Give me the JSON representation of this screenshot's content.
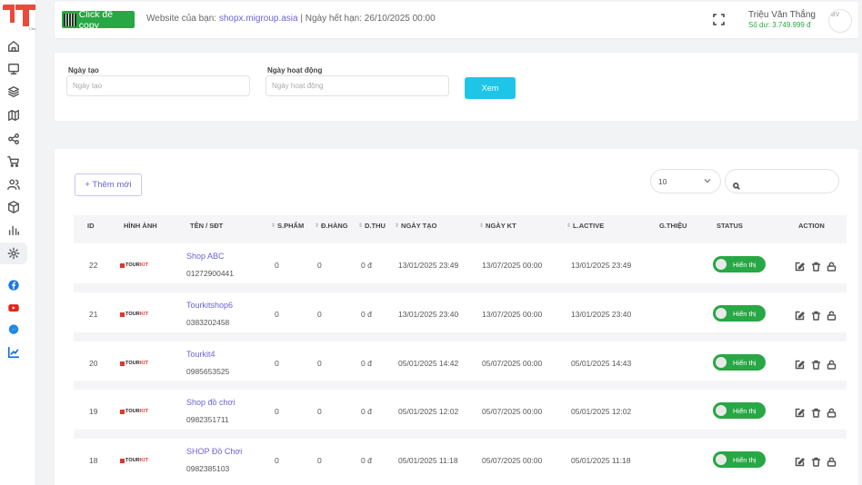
{
  "header": {
    "copy_label": "Click để copy",
    "site_prefix": "Website của bạn: ",
    "site_url": "shopx.migroup.asia",
    "expiry": " | Ngày hết hạn: 26/10/2025 00:00",
    "user_name": "Triệu Văn Thắng",
    "balance": "Số dư: 3.749.999 đ",
    "avatar_alt": "BV"
  },
  "filter": {
    "created_label": "Ngày tạo",
    "created_placeholder": "Ngày tạo",
    "active_label": "Ngày hoạt động",
    "active_placeholder": "Ngày hoạt động",
    "view_label": "Xem"
  },
  "table": {
    "add_label": "+ Thêm mới",
    "page_size": "10",
    "columns": {
      "id": "ID",
      "image": "HÌNH ẢNH",
      "name": "TÊN / SĐT",
      "products": "S.PHẨM",
      "orders": "Đ.HÀNG",
      "revenue": "D.THU",
      "created": "NGÀY TẠO",
      "expiry": "NGÀY KT",
      "last_active": "L.ACTIVE",
      "referral": "G.THIỆU",
      "status": "STATUS",
      "action": "ACTION"
    },
    "rows": [
      {
        "id": "22",
        "name": "Shop ABC",
        "phone": "01272900441",
        "products": "0",
        "orders": "0",
        "revenue": "0 đ",
        "created": "13/01/2025 23:49",
        "expiry": "13/07/2025 00:00",
        "last_active": "13/01/2025 23:49",
        "status": "Hiển thị"
      },
      {
        "id": "21",
        "name": "Tourkitshop6",
        "phone": "0383202458",
        "products": "0",
        "orders": "0",
        "revenue": "0 đ",
        "created": "13/01/2025 23:40",
        "expiry": "13/07/2025 00:00",
        "last_active": "13/01/2025 23:40",
        "status": "Hiển thị"
      },
      {
        "id": "20",
        "name": "Tourkit4",
        "phone": "0985653525",
        "products": "0",
        "orders": "0",
        "revenue": "0 đ",
        "created": "05/01/2025 14:42",
        "expiry": "05/07/2025 00:00",
        "last_active": "05/01/2025 14:43",
        "status": "Hiển thị"
      },
      {
        "id": "19",
        "name": "Shop đồ chơi",
        "phone": "0982351711",
        "products": "0",
        "orders": "0",
        "revenue": "0 đ",
        "created": "05/01/2025 12:02",
        "expiry": "05/07/2025 00:00",
        "last_active": "05/01/2025 12:02",
        "status": "Hiển thị"
      },
      {
        "id": "18",
        "name": "SHOP Đồ Chơi",
        "phone": "0982385103",
        "products": "0",
        "orders": "0",
        "revenue": "0 đ",
        "created": "05/01/2025 11:18",
        "expiry": "05/07/2025 00:00",
        "last_active": "05/01/2025 11:18",
        "status": "Hiển thị"
      }
    ]
  },
  "brand": {
    "logo_text_a": "TOUR",
    "logo_text_b": "KIT",
    "logo_sub": "Chu"
  },
  "colors": {
    "accent": "#6c63d8",
    "success": "#28a745",
    "info": "#1ec5e6",
    "logo": "#ea4a3a"
  },
  "icons": [
    "home-icon",
    "monitor-icon",
    "layers-icon",
    "map-icon",
    "share-icon",
    "cart-icon",
    "users-icon",
    "box-icon",
    "chart-icon",
    "gear-icon",
    "facebook-icon",
    "youtube-icon",
    "messenger-icon",
    "analytics-icon"
  ]
}
